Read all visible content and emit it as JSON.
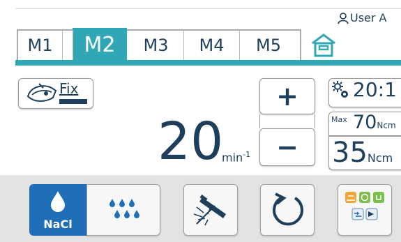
{
  "header": {
    "user_label": "User A"
  },
  "tabs": [
    {
      "label": "M1",
      "active": false
    },
    {
      "label": "M2",
      "active": true
    },
    {
      "label": "M3",
      "active": false
    },
    {
      "label": "M4",
      "active": false
    },
    {
      "label": "M5",
      "active": false
    }
  ],
  "fix": {
    "label": "Fix"
  },
  "speed": {
    "value": "20",
    "unit": "min",
    "unit_exp": "-1"
  },
  "controls": {
    "plus": "+",
    "minus": "−"
  },
  "ratio": {
    "value": "20:1"
  },
  "torque": {
    "max_label": "Max",
    "max_value": "70",
    "max_unit": "Ncm",
    "current_value": "35",
    "current_unit": "Ncm"
  },
  "bottom": {
    "nacl_label": "NaCl"
  },
  "colors": {
    "accent": "#31a7b5",
    "text": "#1e3f5c",
    "active_blue": "#1e6fb8"
  },
  "icons": [
    "user-icon",
    "home-icon",
    "handpiece-icon",
    "gear-icon",
    "drop-icon",
    "spray-icon",
    "light-icon",
    "rotation-icon",
    "apps-icon"
  ]
}
